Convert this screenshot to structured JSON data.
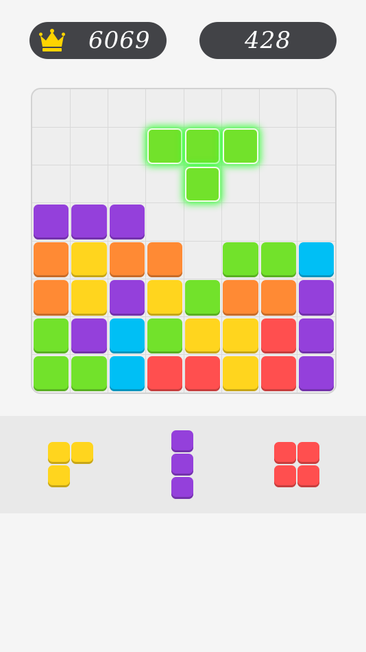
{
  "scores": {
    "best_score": "6069",
    "current_score": "428"
  },
  "icons": {
    "best_icon": "crown-icon"
  },
  "colors": {
    "background": "#f5f5f5",
    "score_pill": "#424347",
    "crown": "#ffd400",
    "board_bg": "#eeeeee",
    "tray_bg": "#e9e9e9",
    "green": "#72e22b",
    "yellow": "#ffd51e",
    "orange": "#ff8a34",
    "purple": "#9440db",
    "blue": "#00bff5",
    "red": "#ff4f4f"
  },
  "board": {
    "rows": 8,
    "cols": 8,
    "cells": [
      [
        null,
        null,
        null,
        null,
        null,
        null,
        null,
        null
      ],
      [
        null,
        null,
        null,
        "green",
        "green",
        "green",
        null,
        null
      ],
      [
        null,
        null,
        null,
        null,
        "green",
        null,
        null,
        null
      ],
      [
        "purple",
        "purple",
        "purple",
        null,
        null,
        null,
        null,
        null
      ],
      [
        "orange",
        "yellow",
        "orange",
        "orange",
        null,
        "green",
        "green",
        "blue"
      ],
      [
        "orange",
        "yellow",
        "purple",
        "yellow",
        "green",
        "orange",
        "orange",
        "purple"
      ],
      [
        "green",
        "purple",
        "blue",
        "green",
        "yellow",
        "yellow",
        "red",
        "purple"
      ],
      [
        "green",
        "green",
        "blue",
        "red",
        "red",
        "yellow",
        "red",
        "purple"
      ]
    ],
    "highlighted_piece": {
      "color": "green",
      "cells": [
        [
          1,
          3
        ],
        [
          1,
          4
        ],
        [
          1,
          5
        ],
        [
          2,
          4
        ]
      ]
    }
  },
  "tray_pieces": [
    {
      "name": "yellow-corner-piece",
      "color": "yellow",
      "cells": [
        [
          0,
          0
        ],
        [
          0,
          1
        ],
        [
          1,
          0
        ]
      ]
    },
    {
      "name": "purple-vertical-piece",
      "color": "purple",
      "cells": [
        [
          0,
          0
        ],
        [
          1,
          0
        ],
        [
          2,
          0
        ]
      ]
    },
    {
      "name": "red-square-piece",
      "color": "red",
      "cells": [
        [
          0,
          0
        ],
        [
          0,
          1
        ],
        [
          1,
          0
        ],
        [
          1,
          1
        ]
      ]
    }
  ]
}
